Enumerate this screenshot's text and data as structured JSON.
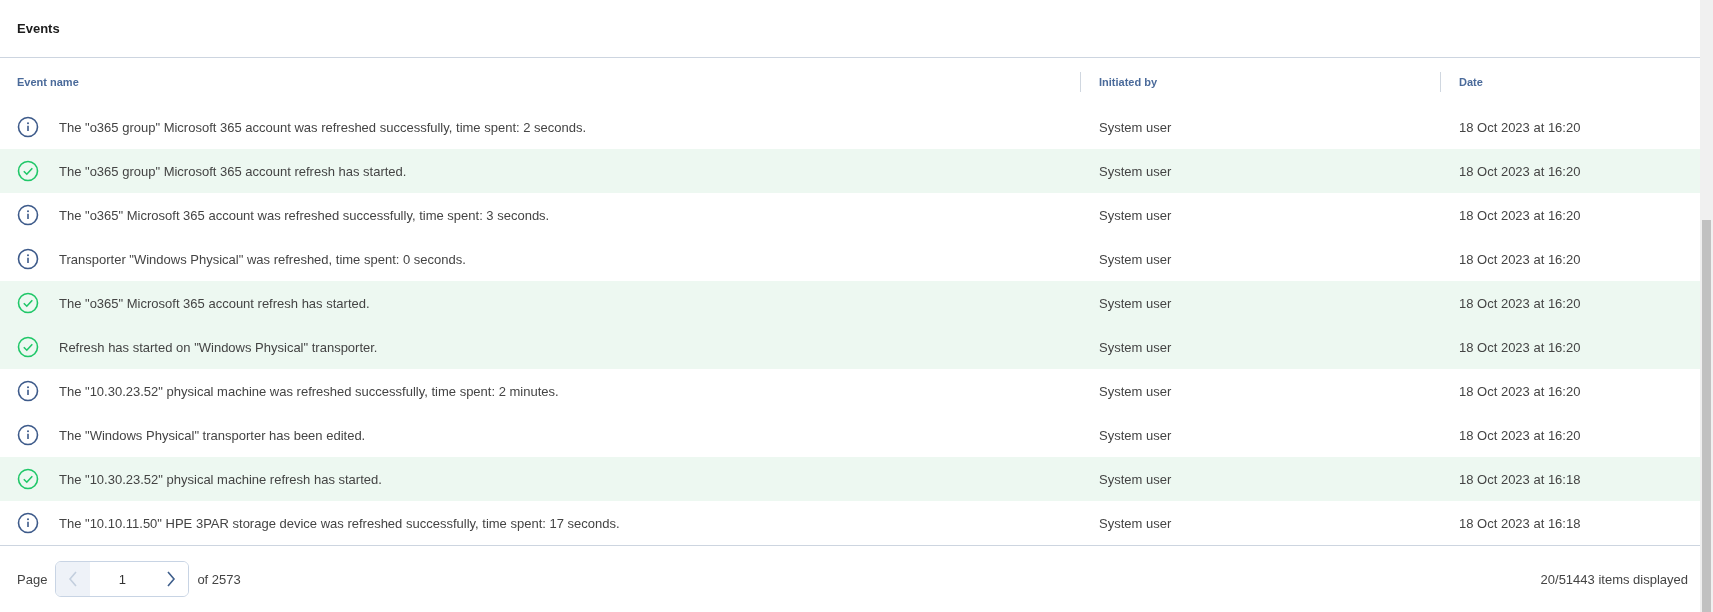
{
  "panel": {
    "title": "Events"
  },
  "table": {
    "columns": [
      "Event name",
      "Initiated by",
      "Date"
    ],
    "rows": [
      {
        "kind": "info",
        "event": "The \"o365 group\" Microsoft 365 account was refreshed successfully, time spent: 2 seconds.",
        "initiated_by": "System user",
        "date": "18 Oct 2023 at 16:20"
      },
      {
        "kind": "success",
        "event": "The \"o365 group\" Microsoft 365 account refresh has started.",
        "initiated_by": "System user",
        "date": "18 Oct 2023 at 16:20"
      },
      {
        "kind": "info",
        "event": "The \"o365\" Microsoft 365 account was refreshed successfully, time spent: 3 seconds.",
        "initiated_by": "System user",
        "date": "18 Oct 2023 at 16:20"
      },
      {
        "kind": "info",
        "event": "Transporter \"Windows Physical\" was refreshed, time spent: 0 seconds.",
        "initiated_by": "System user",
        "date": "18 Oct 2023 at 16:20"
      },
      {
        "kind": "success",
        "event": "The \"o365\" Microsoft 365 account refresh has started.",
        "initiated_by": "System user",
        "date": "18 Oct 2023 at 16:20"
      },
      {
        "kind": "success",
        "event": "Refresh has started on \"Windows Physical\" transporter.",
        "initiated_by": "System user",
        "date": "18 Oct 2023 at 16:20"
      },
      {
        "kind": "info",
        "event": "The \"10.30.23.52\" physical machine was refreshed successfully, time spent: 2 minutes.",
        "initiated_by": "System user",
        "date": "18 Oct 2023 at 16:20"
      },
      {
        "kind": "info",
        "event": "The \"Windows Physical\" transporter has been edited.",
        "initiated_by": "System user",
        "date": "18 Oct 2023 at 16:20"
      },
      {
        "kind": "success",
        "event": "The \"10.30.23.52\" physical machine refresh has started.",
        "initiated_by": "System user",
        "date": "18 Oct 2023 at 16:18"
      },
      {
        "kind": "info",
        "event": "The \"10.10.11.50\" HPE 3PAR storage device was refreshed successfully, time spent: 17 seconds.",
        "initiated_by": "System user",
        "date": "18 Oct 2023 at 16:18"
      }
    ]
  },
  "pagination": {
    "label": "Page",
    "page": "1",
    "of": "of 2573",
    "summary": "20/51443 items displayed",
    "prev_disabled": true
  }
}
